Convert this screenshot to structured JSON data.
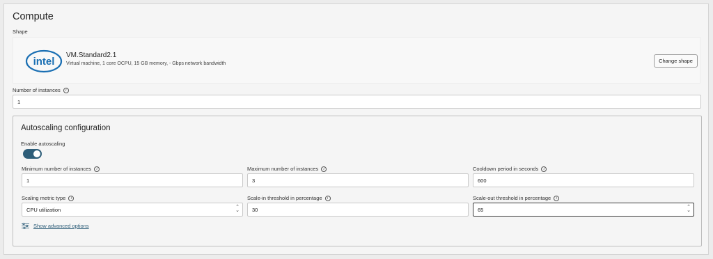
{
  "compute": {
    "title": "Compute",
    "shape_label": "Shape",
    "shape": {
      "logo_text": "intel",
      "name": "VM.Standard2.1",
      "description": "Virtual machine, 1 core OCPU, 15 GB memory, - Gbps network bandwidth",
      "change_button": "Change shape"
    },
    "instances": {
      "label": "Number of instances",
      "value": "1"
    }
  },
  "autoscaling": {
    "title": "Autoscaling configuration",
    "enable_label": "Enable autoscaling",
    "enabled": true,
    "min_instances": {
      "label": "Minimum number of instances",
      "value": "1"
    },
    "max_instances": {
      "label": "Maximum number of instances",
      "value": "3"
    },
    "cooldown": {
      "label": "Cooldown period in seconds",
      "value": "600"
    },
    "metric_type": {
      "label": "Scaling metric type",
      "value": "CPU utilization"
    },
    "scale_in": {
      "label": "Scale-in threshold in percentage",
      "value": "30"
    },
    "scale_out": {
      "label": "Scale-out threshold in percentage",
      "value": "65"
    },
    "advanced_link": "Show advanced options"
  },
  "colors": {
    "accent": "#2e5e79",
    "intel_blue": "#1a6fb3"
  },
  "icons": {
    "info": "info-icon",
    "stepper": "up-down-chevron-icon",
    "advanced": "sliders-icon"
  }
}
